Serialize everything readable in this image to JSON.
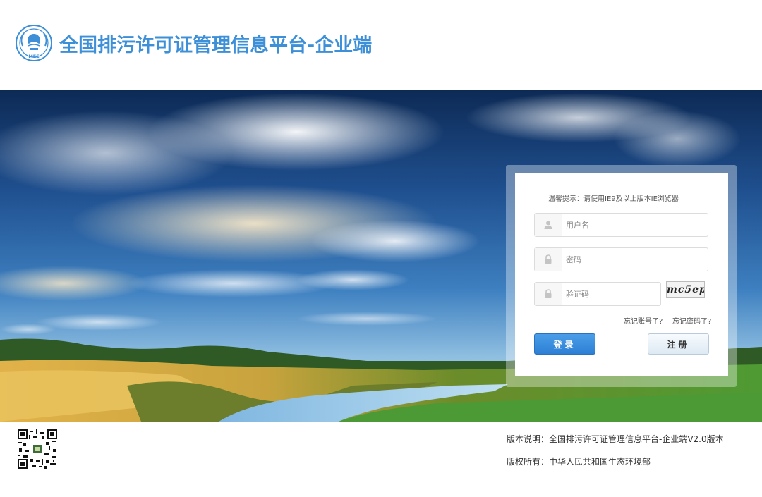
{
  "header": {
    "title": "全国排污许可证管理信息平台-企业端",
    "logo_icon": "mee-emblem-icon",
    "logo_text": "MEE"
  },
  "login": {
    "notice": "温馨提示：请使用IE9及以上版本IE浏览器",
    "username_placeholder": "用户名",
    "password_placeholder": "密码",
    "captcha_placeholder": "验证码",
    "captcha_text": "mc5ep",
    "forgot_account": "忘记账号了?",
    "forgot_password": "忘记密码了?",
    "login_button": "登录",
    "register_button": "注册",
    "user_icon": "user-icon",
    "lock_icon": "lock-icon"
  },
  "footer": {
    "version": "版本说明：全国排污许可证管理信息平台-企业端V2.0版本",
    "copyright": "版权所有：中华人民共和国生态环境部",
    "qrcode_icon": "qr-code-icon"
  },
  "colors": {
    "brand": "#3d8fd8",
    "login_button": "#2c7fd4"
  }
}
